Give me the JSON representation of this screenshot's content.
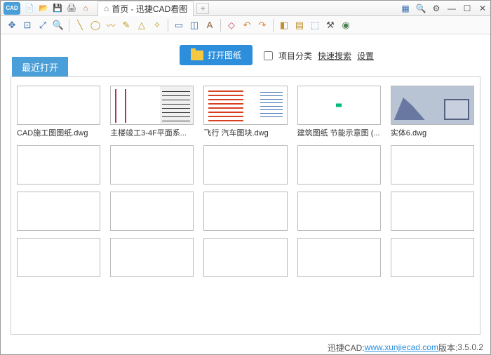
{
  "titlebar": {
    "logo_text": "CAD",
    "tab_title": "首页 - 迅捷CAD看图",
    "new_tab": "+"
  },
  "actions": {
    "open_drawing": "打开图纸",
    "project_category": "项目分类",
    "quick_search": "快速搜索",
    "settings": "设置"
  },
  "recent": {
    "label": "最近打开",
    "files": [
      {
        "name": "CAD施工图图纸.dwg"
      },
      {
        "name": "主楼竣工3-4F平面系..."
      },
      {
        "name": "飞行 汽车图块.dwg"
      },
      {
        "name": "建筑图纸 节能示意图 (..."
      },
      {
        "name": "实体6.dwg"
      }
    ]
  },
  "status": {
    "prefix": "迅捷CAD: ",
    "url": "www.xunjiecad.com",
    "version_label": " 版本: ",
    "version": "3.5.0.2"
  },
  "win": {
    "min": "—",
    "max": "☐",
    "close": "✕"
  }
}
